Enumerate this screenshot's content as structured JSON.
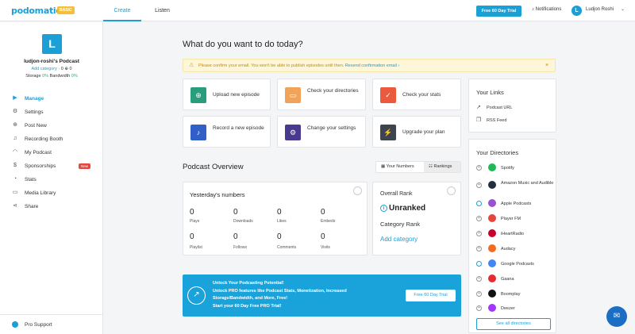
{
  "header": {
    "logo": "podomatic",
    "plan_badge": "BASIC",
    "tabs": [
      {
        "label": "Create"
      },
      {
        "label": "Listen"
      }
    ],
    "trial_button": "Free 60 Day Trial",
    "notifications": "Notifications",
    "user_initial": "L",
    "user_name": "Ludjon Roshi",
    "caret": "⌄"
  },
  "sidebar": {
    "avatar_initial": "L",
    "podcast_name": "ludjon-roshi's Podcast",
    "add_category": "Add category",
    "category_counts": "· 0 ⊕ 0",
    "storage_label": "Storage",
    "storage_pct": "0%",
    "bandwidth_label": "Bandwidth",
    "bandwidth_pct": "0%",
    "items": [
      {
        "label": "Manage",
        "icon": "play-circle-icon",
        "glyph": "▶"
      },
      {
        "label": "Settings",
        "icon": "gear-icon",
        "glyph": "⚙"
      },
      {
        "label": "Post New",
        "icon": "plus-icon",
        "glyph": "⊕"
      },
      {
        "label": "Recording Booth",
        "icon": "microphone-icon",
        "glyph": "♫"
      },
      {
        "label": "My Podcast",
        "icon": "headphones-icon",
        "glyph": "◠"
      },
      {
        "label": "Sponsorships",
        "icon": "dollar-icon",
        "glyph": "$"
      },
      {
        "label": "Stats",
        "icon": "chart-icon",
        "glyph": "◔"
      },
      {
        "label": "Media Library",
        "icon": "folder-icon",
        "glyph": "▭"
      },
      {
        "label": "Share",
        "icon": "share-icon",
        "glyph": "⋖"
      }
    ],
    "new_badge": "New",
    "pro_support": "Pro Support"
  },
  "main": {
    "heading": "What do you want to do today?",
    "alert_text": "Please confirm your email. You won't be able to publish episodes until then.",
    "alert_link": "Resend confirmation email ›",
    "alert_close": "×",
    "actions": [
      {
        "label": "Upload new episode",
        "color": "#2a9d7d",
        "glyph": "⊕",
        "icon": "upload-icon"
      },
      {
        "label": "Check your directories",
        "color": "#f2a35a",
        "glyph": "▭",
        "icon": "folder-icon"
      },
      {
        "label": "Check your stats",
        "color": "#ec5a3e",
        "glyph": "✓",
        "icon": "stats-icon"
      },
      {
        "label": "Record a new episode",
        "color": "#2f5fc7",
        "glyph": "♪",
        "icon": "microphone-icon"
      },
      {
        "label": "Change your settings",
        "color": "#4a3a8f",
        "glyph": "⚙",
        "icon": "gear-icon"
      },
      {
        "label": "Upgrade your plan",
        "color": "#3d4450",
        "glyph": "⚡",
        "icon": "lightning-icon"
      }
    ],
    "overview_title": "Podcast Overview",
    "toggle_numbers": "Your Numbers",
    "toggle_rankings": "Rankings",
    "yesterday_title": "Yesterday's numbers",
    "stats_row1": [
      {
        "value": "0",
        "label": "Plays"
      },
      {
        "value": "0",
        "label": "Downloads"
      },
      {
        "value": "0",
        "label": "Likes"
      },
      {
        "value": "0",
        "label": "Embeds"
      }
    ],
    "stats_row2": [
      {
        "value": "0",
        "label": "Playlist"
      },
      {
        "value": "0",
        "label": "Follows"
      },
      {
        "value": "0",
        "label": "Comments"
      },
      {
        "value": "0",
        "label": "Visits"
      }
    ],
    "overall_rank_label": "Overall Rank",
    "rank_value": "Unranked",
    "category_rank_label": "Category Rank",
    "add_category_link": "Add category",
    "banner": {
      "line1": "Unlock Your Podcasting Potential!",
      "line2": "Unlock PRO features like Podcast Stats, Monetization, Increased Storage/Bandwidth, and More, Free!",
      "line3": "Start your 60 Day Free PRO Trial!",
      "button": "Free 60 Day Trial"
    }
  },
  "links_panel": {
    "title": "Your Links",
    "items": [
      {
        "label": "Podcast URL",
        "glyph": "↗",
        "icon": "external-link-icon"
      },
      {
        "label": "RSS Feed",
        "glyph": "❐",
        "icon": "copy-icon"
      }
    ]
  },
  "directories_panel": {
    "title": "Your Directories",
    "items": [
      {
        "label": "Spotify",
        "color": "#1db954"
      },
      {
        "label": "Amazon Music and Audible",
        "color": "#232f3e"
      },
      {
        "label": "Apple Podcasts",
        "color": "#9b4fd6"
      },
      {
        "label": "Player FM",
        "color": "#e8453c"
      },
      {
        "label": "iHeartRadio",
        "color": "#c6002b"
      },
      {
        "label": "Audacy",
        "color": "#f26b21"
      },
      {
        "label": "Google Podcasts",
        "color": "#4285f4"
      },
      {
        "label": "Gaana",
        "color": "#e72c30"
      },
      {
        "label": "Boomplay",
        "color": "#111111"
      },
      {
        "label": "Deezer",
        "color": "#a238ff"
      }
    ],
    "see_all": "See all directories"
  }
}
